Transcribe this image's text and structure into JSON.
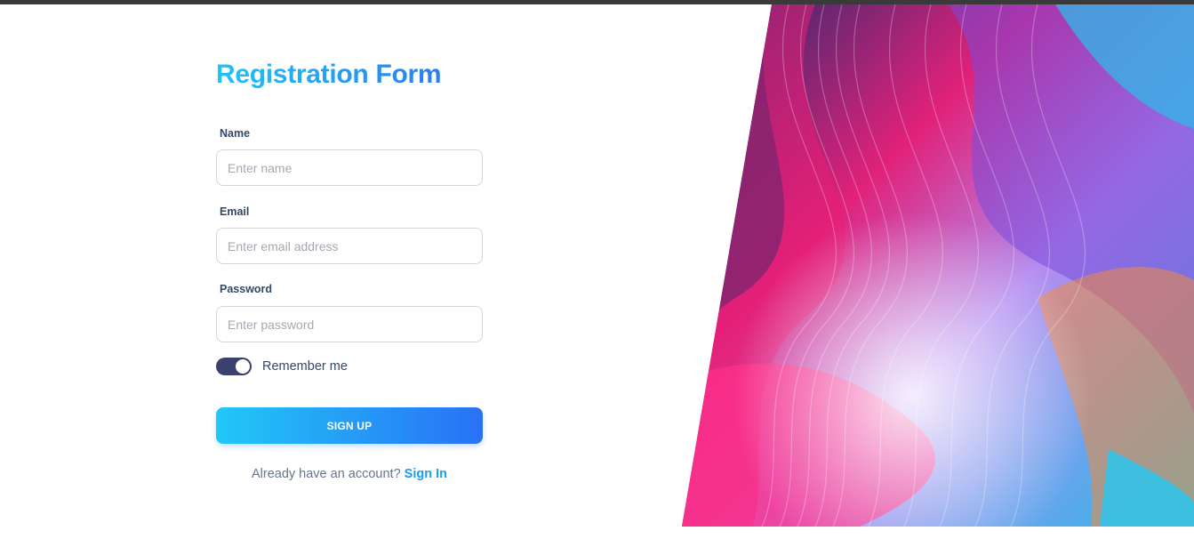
{
  "form": {
    "title": "Registration Form",
    "name_label": "Name",
    "name_placeholder": "Enter name",
    "email_label": "Email",
    "email_placeholder": "Enter email address",
    "password_label": "Password",
    "password_placeholder": "Enter password",
    "remember_label": "Remember me",
    "remember_checked": true,
    "signup_label": "SIGN UP",
    "account_text": "Already have an account?",
    "signin_label": "Sign In"
  },
  "colors": {
    "title_gradient": [
      "#21c4f6",
      "#2a7ef0"
    ],
    "button_gradient": [
      "#21c8f7",
      "#2971f5"
    ],
    "toggle_on": "#3a416f",
    "link": "#1a9cf0",
    "label": "#344767"
  },
  "decorative_image": "abstract-swirl-artwork"
}
